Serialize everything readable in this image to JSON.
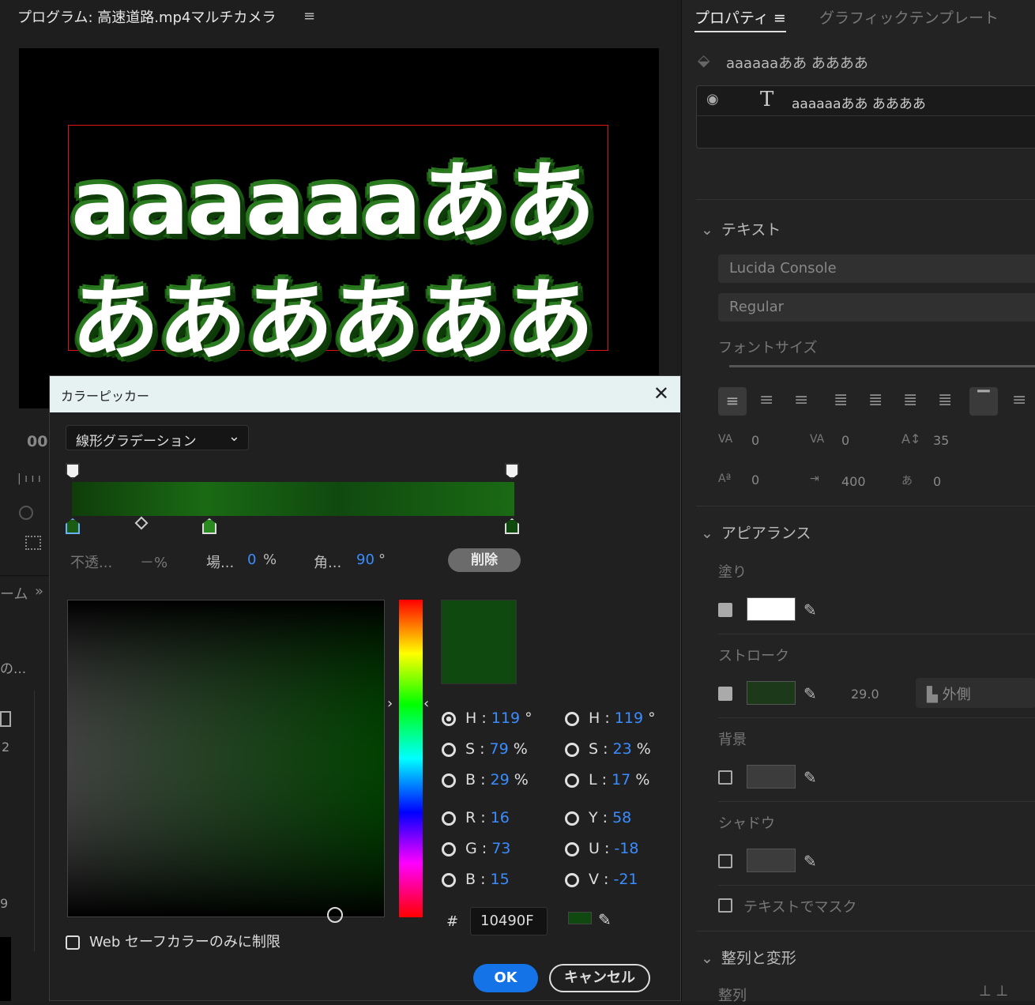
{
  "monitor": {
    "title": "プログラム: 高速道路.mp4マルチカメラ",
    "menu_icon": "≡",
    "text_line1": "aaaaaaああ",
    "text_line2": "ああああああ",
    "timecode_partial": "00",
    "left_partial_1": "ーム",
    "left_partial_2": "の...",
    "left_partial_3": "2",
    "left_partial_4": "9",
    "expand": "»"
  },
  "dialog": {
    "title": "カラーピッカー",
    "close": "✕",
    "gradient_type": "線形グラデーション",
    "opacity_label": "不透...",
    "opacity_value": "－%",
    "location_label": "場...",
    "location_value": "0",
    "location_unit": "%",
    "angle_label": "角...",
    "angle_value": "90",
    "angle_unit": "°",
    "delete": "削除",
    "params_left": [
      {
        "key": "H",
        "value": "119",
        "unit": "°"
      },
      {
        "key": "S",
        "value": "79",
        "unit": "%"
      },
      {
        "key": "B",
        "value": "29",
        "unit": "%"
      },
      {
        "key": "R",
        "value": "16",
        "unit": ""
      },
      {
        "key": "G",
        "value": "73",
        "unit": ""
      },
      {
        "key": "B",
        "value": "15",
        "unit": ""
      }
    ],
    "params_right": [
      {
        "key": "H",
        "value": "119",
        "unit": "°"
      },
      {
        "key": "S",
        "value": "23",
        "unit": "%"
      },
      {
        "key": "L",
        "value": "17",
        "unit": "%"
      },
      {
        "key": "Y",
        "value": "58",
        "unit": ""
      },
      {
        "key": "U",
        "value": "-18",
        "unit": ""
      },
      {
        "key": "V",
        "value": "-21",
        "unit": ""
      }
    ],
    "hex_label": "#",
    "hex_value": "10490F",
    "websafe": "Web セーフカラーのみに制限",
    "ok": "OK",
    "cancel": "キャンセル",
    "current_color": "#10490f"
  },
  "properties": {
    "tab_active": "プロパティ",
    "tab_menu": "≡",
    "tab_other": "グラフィックテンプレート",
    "clip_name": "aaaaaaああ ああああ",
    "layer_name": "aaaaaaああ ああああ",
    "text_section": "テキスト",
    "font": "Lucida Console",
    "style": "Regular",
    "font_size_label": "フォントサイズ",
    "kerning": "0",
    "tracking": "0",
    "leading": "35",
    "baseline": "0",
    "tsume": "400",
    "tab_width": "0",
    "appearance_section": "アピアランス",
    "fill_label": "塗り",
    "stroke_label": "ストローク",
    "stroke_width": "29.0",
    "stroke_position": "外側",
    "background_label": "背景",
    "shadow_label": "シャドウ",
    "mask_label": "テキストでマスク",
    "align_section": "整列と変形",
    "align_label": "整列"
  }
}
